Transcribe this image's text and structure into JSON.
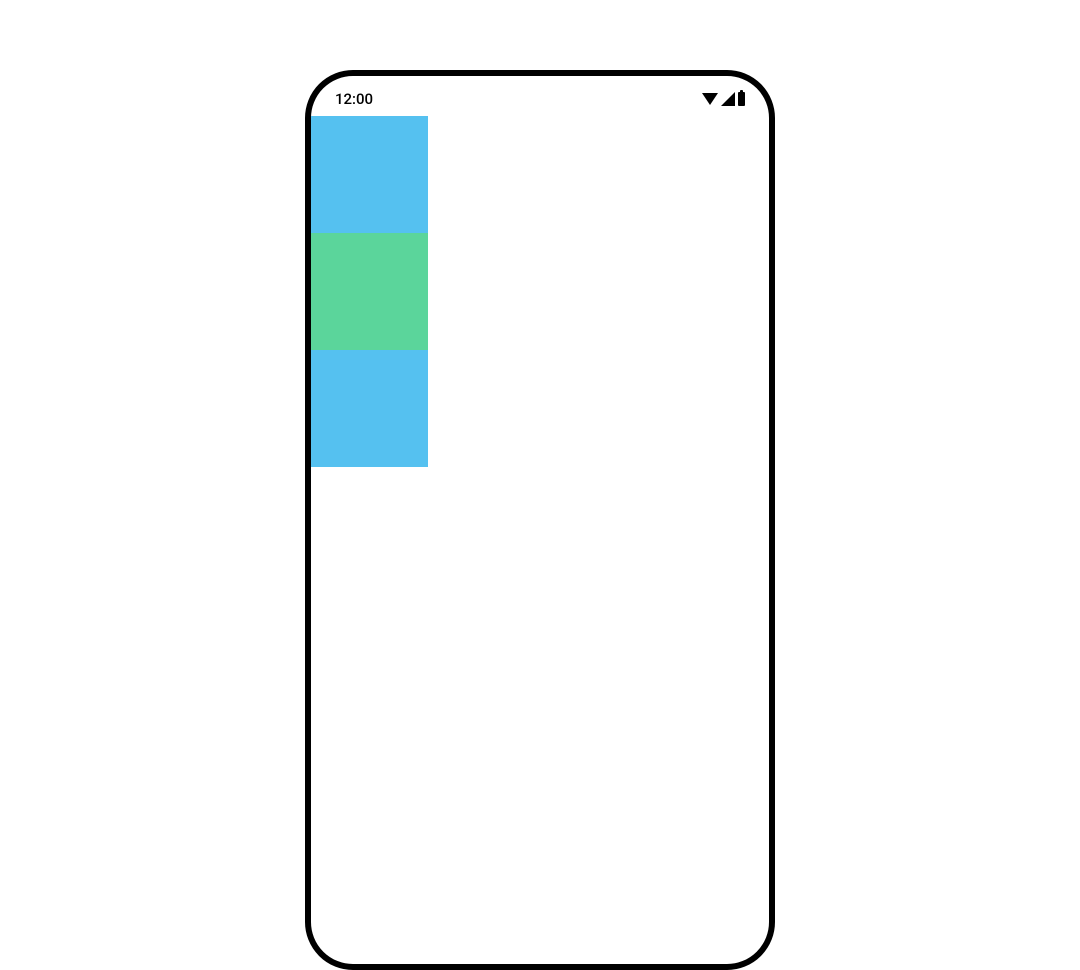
{
  "status_bar": {
    "time": "12:00"
  },
  "blocks": {
    "top_color": "#55c1f0",
    "middle_color": "#5bd59b",
    "bottom_color": "#55c1f0"
  }
}
